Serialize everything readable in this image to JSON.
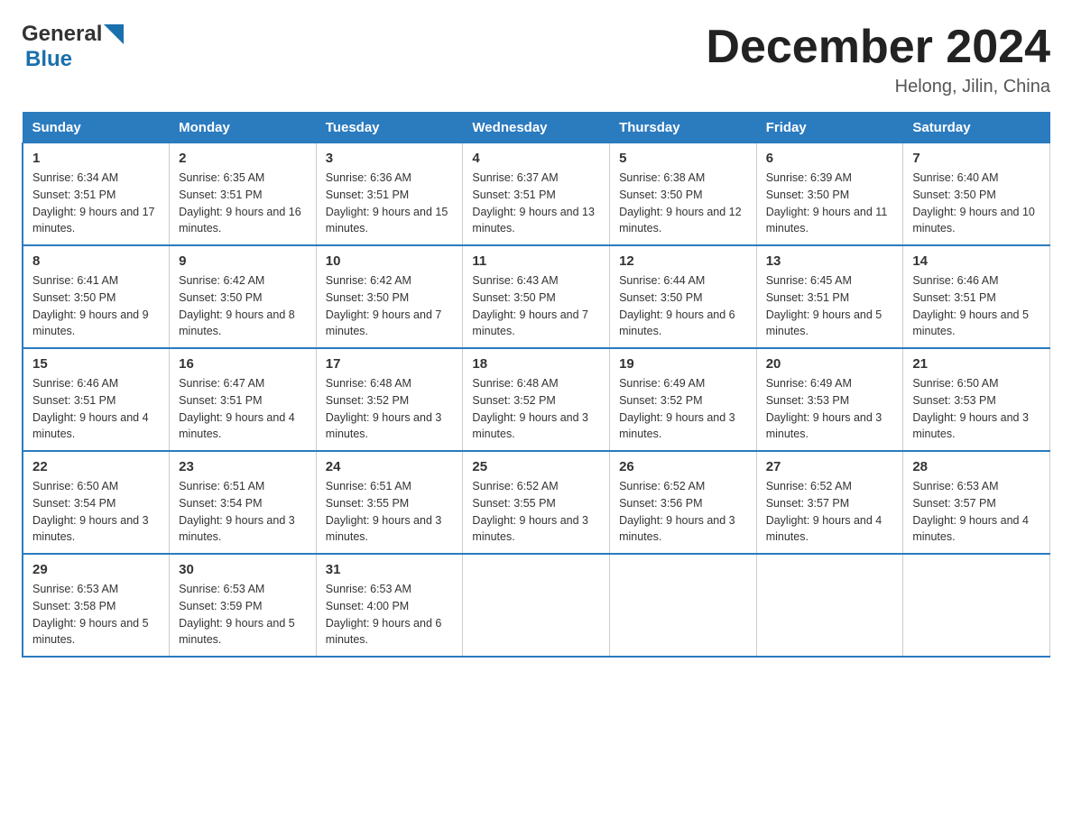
{
  "header": {
    "logo_general": "General",
    "logo_blue": "Blue",
    "month_title": "December 2024",
    "location": "Helong, Jilin, China"
  },
  "days_of_week": [
    "Sunday",
    "Monday",
    "Tuesday",
    "Wednesday",
    "Thursday",
    "Friday",
    "Saturday"
  ],
  "weeks": [
    [
      {
        "day": "1",
        "sunrise": "6:34 AM",
        "sunset": "3:51 PM",
        "daylight": "9 hours and 17 minutes."
      },
      {
        "day": "2",
        "sunrise": "6:35 AM",
        "sunset": "3:51 PM",
        "daylight": "9 hours and 16 minutes."
      },
      {
        "day": "3",
        "sunrise": "6:36 AM",
        "sunset": "3:51 PM",
        "daylight": "9 hours and 15 minutes."
      },
      {
        "day": "4",
        "sunrise": "6:37 AM",
        "sunset": "3:51 PM",
        "daylight": "9 hours and 13 minutes."
      },
      {
        "day": "5",
        "sunrise": "6:38 AM",
        "sunset": "3:50 PM",
        "daylight": "9 hours and 12 minutes."
      },
      {
        "day": "6",
        "sunrise": "6:39 AM",
        "sunset": "3:50 PM",
        "daylight": "9 hours and 11 minutes."
      },
      {
        "day": "7",
        "sunrise": "6:40 AM",
        "sunset": "3:50 PM",
        "daylight": "9 hours and 10 minutes."
      }
    ],
    [
      {
        "day": "8",
        "sunrise": "6:41 AM",
        "sunset": "3:50 PM",
        "daylight": "9 hours and 9 minutes."
      },
      {
        "day": "9",
        "sunrise": "6:42 AM",
        "sunset": "3:50 PM",
        "daylight": "9 hours and 8 minutes."
      },
      {
        "day": "10",
        "sunrise": "6:42 AM",
        "sunset": "3:50 PM",
        "daylight": "9 hours and 7 minutes."
      },
      {
        "day": "11",
        "sunrise": "6:43 AM",
        "sunset": "3:50 PM",
        "daylight": "9 hours and 7 minutes."
      },
      {
        "day": "12",
        "sunrise": "6:44 AM",
        "sunset": "3:50 PM",
        "daylight": "9 hours and 6 minutes."
      },
      {
        "day": "13",
        "sunrise": "6:45 AM",
        "sunset": "3:51 PM",
        "daylight": "9 hours and 5 minutes."
      },
      {
        "day": "14",
        "sunrise": "6:46 AM",
        "sunset": "3:51 PM",
        "daylight": "9 hours and 5 minutes."
      }
    ],
    [
      {
        "day": "15",
        "sunrise": "6:46 AM",
        "sunset": "3:51 PM",
        "daylight": "9 hours and 4 minutes."
      },
      {
        "day": "16",
        "sunrise": "6:47 AM",
        "sunset": "3:51 PM",
        "daylight": "9 hours and 4 minutes."
      },
      {
        "day": "17",
        "sunrise": "6:48 AM",
        "sunset": "3:52 PM",
        "daylight": "9 hours and 3 minutes."
      },
      {
        "day": "18",
        "sunrise": "6:48 AM",
        "sunset": "3:52 PM",
        "daylight": "9 hours and 3 minutes."
      },
      {
        "day": "19",
        "sunrise": "6:49 AM",
        "sunset": "3:52 PM",
        "daylight": "9 hours and 3 minutes."
      },
      {
        "day": "20",
        "sunrise": "6:49 AM",
        "sunset": "3:53 PM",
        "daylight": "9 hours and 3 minutes."
      },
      {
        "day": "21",
        "sunrise": "6:50 AM",
        "sunset": "3:53 PM",
        "daylight": "9 hours and 3 minutes."
      }
    ],
    [
      {
        "day": "22",
        "sunrise": "6:50 AM",
        "sunset": "3:54 PM",
        "daylight": "9 hours and 3 minutes."
      },
      {
        "day": "23",
        "sunrise": "6:51 AM",
        "sunset": "3:54 PM",
        "daylight": "9 hours and 3 minutes."
      },
      {
        "day": "24",
        "sunrise": "6:51 AM",
        "sunset": "3:55 PM",
        "daylight": "9 hours and 3 minutes."
      },
      {
        "day": "25",
        "sunrise": "6:52 AM",
        "sunset": "3:55 PM",
        "daylight": "9 hours and 3 minutes."
      },
      {
        "day": "26",
        "sunrise": "6:52 AM",
        "sunset": "3:56 PM",
        "daylight": "9 hours and 3 minutes."
      },
      {
        "day": "27",
        "sunrise": "6:52 AM",
        "sunset": "3:57 PM",
        "daylight": "9 hours and 4 minutes."
      },
      {
        "day": "28",
        "sunrise": "6:53 AM",
        "sunset": "3:57 PM",
        "daylight": "9 hours and 4 minutes."
      }
    ],
    [
      {
        "day": "29",
        "sunrise": "6:53 AM",
        "sunset": "3:58 PM",
        "daylight": "9 hours and 5 minutes."
      },
      {
        "day": "30",
        "sunrise": "6:53 AM",
        "sunset": "3:59 PM",
        "daylight": "9 hours and 5 minutes."
      },
      {
        "day": "31",
        "sunrise": "6:53 AM",
        "sunset": "4:00 PM",
        "daylight": "9 hours and 6 minutes."
      },
      null,
      null,
      null,
      null
    ]
  ]
}
